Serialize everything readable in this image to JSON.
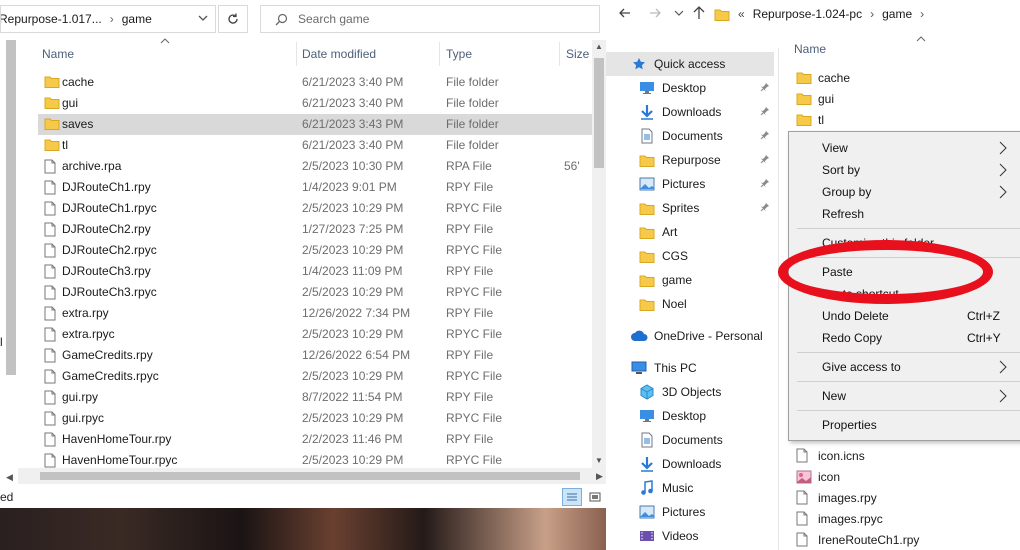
{
  "left": {
    "address": "Repurpose-1.017... › game",
    "address_part1": "Repurpose-1.017...",
    "address_part2": "game",
    "search_placeholder": "Search game",
    "columns": {
      "name": "Name",
      "date": "Date modified",
      "type": "Type",
      "size": "Size"
    },
    "files": [
      {
        "name": "cache",
        "date": "6/21/2023 3:40 PM",
        "type": "File folder",
        "size": "",
        "kind": "folder"
      },
      {
        "name": "gui",
        "date": "6/21/2023 3:40 PM",
        "type": "File folder",
        "size": "",
        "kind": "folder"
      },
      {
        "name": "saves",
        "date": "6/21/2023 3:43 PM",
        "type": "File folder",
        "size": "",
        "kind": "folder",
        "selected": true
      },
      {
        "name": "tl",
        "date": "6/21/2023 3:40 PM",
        "type": "File folder",
        "size": "",
        "kind": "folder"
      },
      {
        "name": "archive.rpa",
        "date": "2/5/2023 10:30 PM",
        "type": "RPA File",
        "size": "56'",
        "kind": "file"
      },
      {
        "name": "DJRouteCh1.rpy",
        "date": "1/4/2023 9:01 PM",
        "type": "RPY File",
        "size": "",
        "kind": "file"
      },
      {
        "name": "DJRouteCh1.rpyc",
        "date": "2/5/2023 10:29 PM",
        "type": "RPYC File",
        "size": "",
        "kind": "file"
      },
      {
        "name": "DJRouteCh2.rpy",
        "date": "1/27/2023 7:25 PM",
        "type": "RPY File",
        "size": "",
        "kind": "file"
      },
      {
        "name": "DJRouteCh2.rpyc",
        "date": "2/5/2023 10:29 PM",
        "type": "RPYC File",
        "size": "",
        "kind": "file"
      },
      {
        "name": "DJRouteCh3.rpy",
        "date": "1/4/2023 11:09 PM",
        "type": "RPY File",
        "size": "",
        "kind": "file"
      },
      {
        "name": "DJRouteCh3.rpyc",
        "date": "2/5/2023 10:29 PM",
        "type": "RPYC File",
        "size": "",
        "kind": "file"
      },
      {
        "name": "extra.rpy",
        "date": "12/26/2022 7:34 PM",
        "type": "RPY File",
        "size": "",
        "kind": "file"
      },
      {
        "name": "extra.rpyc",
        "date": "2/5/2023 10:29 PM",
        "type": "RPYC File",
        "size": "",
        "kind": "file"
      },
      {
        "name": "GameCredits.rpy",
        "date": "12/26/2022 6:54 PM",
        "type": "RPY File",
        "size": "",
        "kind": "file"
      },
      {
        "name": "GameCredits.rpyc",
        "date": "2/5/2023 10:29 PM",
        "type": "RPYC File",
        "size": "",
        "kind": "file"
      },
      {
        "name": "gui.rpy",
        "date": "8/7/2022 11:54 PM",
        "type": "RPY File",
        "size": "",
        "kind": "file"
      },
      {
        "name": "gui.rpyc",
        "date": "2/5/2023 10:29 PM",
        "type": "RPYC File",
        "size": "",
        "kind": "file"
      },
      {
        "name": "HavenHomeTour.rpy",
        "date": "2/2/2023 11:46 PM",
        "type": "RPY File",
        "size": "",
        "kind": "file"
      },
      {
        "name": "HavenHomeTour.rpyc",
        "date": "2/5/2023 10:29 PM",
        "type": "RPYC File",
        "size": "",
        "kind": "file"
      }
    ],
    "edge_text_1": "l",
    "edge_text_2": "ed"
  },
  "right": {
    "breadcrumb": [
      "«",
      "Repurpose-1.024-pc",
      "›",
      "game",
      "›"
    ],
    "column_name": "Name",
    "nav": [
      {
        "label": "Quick access",
        "icon": "star-icon",
        "pin": false,
        "kind": "qa"
      },
      {
        "label": "Desktop",
        "icon": "desktop-icon",
        "pin": true
      },
      {
        "label": "Downloads",
        "icon": "download-icon",
        "pin": true
      },
      {
        "label": "Documents",
        "icon": "document-icon",
        "pin": true
      },
      {
        "label": "Repurpose",
        "icon": "folder-icon",
        "pin": true
      },
      {
        "label": "Pictures",
        "icon": "pictures-icon",
        "pin": true
      },
      {
        "label": "Sprites",
        "icon": "folder-icon",
        "pin": true
      },
      {
        "label": "Art",
        "icon": "folder-icon",
        "pin": false
      },
      {
        "label": "CGS",
        "icon": "folder-icon",
        "pin": false
      },
      {
        "label": "game",
        "icon": "folder-icon",
        "pin": false
      },
      {
        "label": "Noel",
        "icon": "folder-icon",
        "pin": false
      },
      {
        "label": "OneDrive - Personal",
        "icon": "cloud-icon",
        "pin": false,
        "kind": "top"
      },
      {
        "label": "This PC",
        "icon": "pc-icon",
        "pin": false,
        "kind": "top"
      },
      {
        "label": "3D Objects",
        "icon": "cube-icon",
        "pin": false
      },
      {
        "label": "Desktop",
        "icon": "desktop-icon",
        "pin": false
      },
      {
        "label": "Documents",
        "icon": "document-icon",
        "pin": false
      },
      {
        "label": "Downloads",
        "icon": "download-icon",
        "pin": false
      },
      {
        "label": "Music",
        "icon": "music-icon",
        "pin": false
      },
      {
        "label": "Pictures",
        "icon": "pictures-icon",
        "pin": false
      },
      {
        "label": "Videos",
        "icon": "video-icon",
        "pin": false
      }
    ],
    "files_top": [
      {
        "name": "cache"
      },
      {
        "name": "gui"
      },
      {
        "name": "tl"
      }
    ],
    "files_bottom": [
      {
        "name": "icon.icns",
        "kind": "file"
      },
      {
        "name": "icon",
        "kind": "image"
      },
      {
        "name": "images.rpy",
        "kind": "file"
      },
      {
        "name": "images.rpyc",
        "kind": "file"
      },
      {
        "name": "IreneRouteCh1.rpy",
        "kind": "file"
      }
    ]
  },
  "menu": {
    "view": "View",
    "sort_by": "Sort by",
    "group_by": "Group by",
    "refresh": "Refresh",
    "customize": "Customize this folder...",
    "paste": "Paste",
    "paste_shortcut": "Paste shortcut",
    "undo_delete": "Undo Delete",
    "undo_shortcut": "Ctrl+Z",
    "redo_copy": "Redo Copy",
    "redo_shortcut": "Ctrl+Y",
    "give_access": "Give access to",
    "new": "New",
    "properties": "Properties"
  },
  "colors": {
    "highlight_circle": "#e8101c",
    "folder": "#f7c948",
    "selection": "#d9d9d9"
  }
}
